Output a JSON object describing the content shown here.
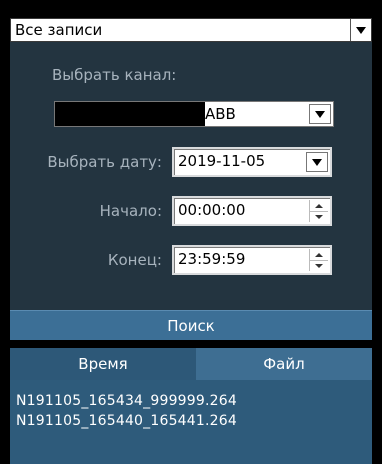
{
  "record_type": {
    "value": "Все записи"
  },
  "channel": {
    "label": "Выбрать канал:",
    "value_visible": "ABB"
  },
  "date": {
    "label": "Выбрать дату:",
    "value": "2019-11-05"
  },
  "start": {
    "label": "Начало:",
    "value": "00:00:00"
  },
  "end": {
    "label": "Конец:",
    "value": "23:59:59"
  },
  "search_button": "Поиск",
  "tabs": {
    "time": "Время",
    "file": "Файл"
  },
  "results": [
    "N191105_165434_999999.264",
    "N191105_165440_165441.264"
  ],
  "colors": {
    "panel": "#233440",
    "button": "#3c6f96",
    "tab_active": "#3e6e92",
    "tab_inactive": "#2d5878",
    "results_bg": "#2e5b7b"
  }
}
